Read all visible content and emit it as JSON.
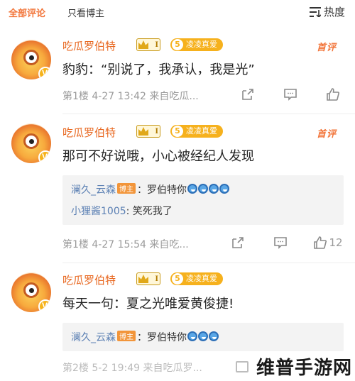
{
  "filters": {
    "all": "全部评论",
    "op_only": "只看博主",
    "sort": "热度"
  },
  "comments": [
    {
      "name": "吃瓜罗伯特",
      "level": "I",
      "tag_num": "5",
      "tag_text": "凌凌真爱",
      "badge": "首评",
      "text": "豹豹：“别说了，我承认，我是光”",
      "meta": "第1楼  4-27 13:42  来自吃瓜...",
      "likes": ""
    },
    {
      "name": "吃瓜罗伯特",
      "level": "I",
      "tag_num": "5",
      "tag_text": "凌凌真爱",
      "badge": "首评",
      "text": "那可不好说哦，小心被经纪人发现",
      "meta": "第1楼  4-27 15:54  来自吃...",
      "likes": "12",
      "replies": [
        {
          "name": "澜久_云森",
          "host": "博主",
          "text": "：罗伯特你"
        },
        {
          "name": "小狸酱1005",
          "text": ": 笑死我了"
        }
      ]
    },
    {
      "name": "吃瓜罗伯特",
      "level": "I",
      "tag_num": "5",
      "tag_text": "凌凌真爱",
      "text": "每天一句：夏之光唯爱黄俊捷!",
      "meta": "第2楼  5-2 19:49  来自吃瓜罗...",
      "replies": [
        {
          "name": "澜久_云森",
          "host": "博主",
          "text": "：罗伯特你"
        }
      ]
    }
  ],
  "watermark": "维普手游网",
  "colors": {
    "accent": "#f2753a",
    "link": "#5a7fb3",
    "tag": "#f6b11d"
  }
}
